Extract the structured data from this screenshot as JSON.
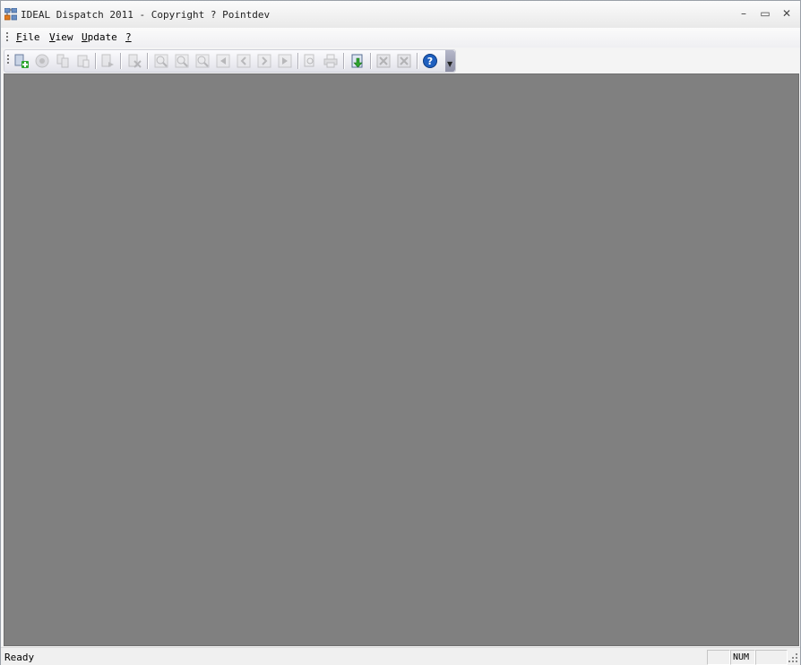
{
  "window": {
    "title": "IDEAL Dispatch 2011 - Copyright ? Pointdev",
    "controls": {
      "minimize": "–",
      "maximize": "▭",
      "close": "✕"
    }
  },
  "menubar": {
    "items": [
      {
        "prefix": "",
        "accel": "F",
        "rest": "ile"
      },
      {
        "prefix": "",
        "accel": "V",
        "rest": "iew"
      },
      {
        "prefix": "",
        "accel": "U",
        "rest": "pdate"
      },
      {
        "prefix": "",
        "accel": "?",
        "rest": ""
      }
    ]
  },
  "toolbar": {
    "buttons": [
      {
        "icon": "new-document-icon",
        "enabled": true
      },
      {
        "icon": "record-icon",
        "enabled": false
      },
      {
        "icon": "copy-icon",
        "enabled": false
      },
      {
        "icon": "paste-icon",
        "enabled": false
      },
      {
        "icon": "export-icon",
        "enabled": false
      },
      {
        "icon": "delete-icon",
        "enabled": false
      },
      {
        "icon": "zoom-in-icon",
        "enabled": false
      },
      {
        "icon": "zoom-out-icon",
        "enabled": false
      },
      {
        "icon": "zoom-icon",
        "enabled": false
      },
      {
        "icon": "first-icon",
        "enabled": false
      },
      {
        "icon": "previous-icon",
        "enabled": false
      },
      {
        "icon": "next-icon",
        "enabled": false
      },
      {
        "icon": "last-icon",
        "enabled": false
      },
      {
        "icon": "preview-icon",
        "enabled": false
      },
      {
        "icon": "print-icon",
        "enabled": false
      },
      {
        "icon": "download-icon",
        "enabled": true
      },
      {
        "icon": "excel-export-icon",
        "enabled": false
      },
      {
        "icon": "excel-import-icon",
        "enabled": false
      },
      {
        "icon": "help-icon",
        "enabled": true
      }
    ],
    "overflow_glyph": "▼"
  },
  "statusbar": {
    "text": "Ready",
    "num_indicator": "NUM"
  },
  "colors": {
    "client_background": "#808080",
    "help_blue": "#1f5fbf",
    "add_green": "#2fa52f"
  }
}
